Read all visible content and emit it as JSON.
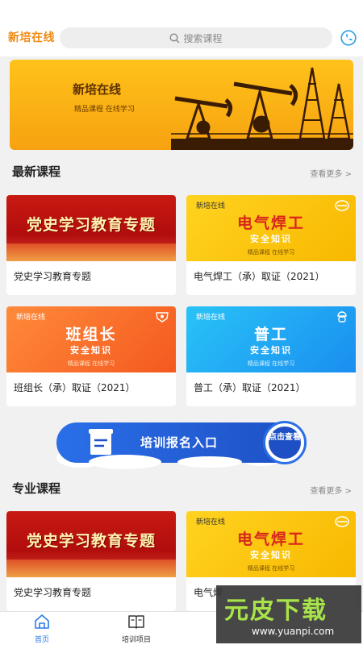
{
  "header": {
    "logo": "新培在线",
    "search_placeholder": "搜索课程",
    "icons": {
      "search": "search-icon",
      "phone": "phone-icon"
    }
  },
  "banner": {
    "title": "新培在线",
    "subtitle": "精品课程 在线学习"
  },
  "latest": {
    "title": "最新课程",
    "more": "查看更多 >",
    "courses": [
      {
        "title": "党史学习教育专题",
        "thumb_text": "党史学习教育专题"
      },
      {
        "title": "电气焊工（承）取证（2021）",
        "brand": "新培在线",
        "big": "电气焊工",
        "small": "安全知识",
        "tagline": "精品课程 在线学习"
      },
      {
        "title": "班组长（承）取证（2021）",
        "brand": "新培在线",
        "big": "班组长",
        "small": "安全知识",
        "tagline": "精品课程 在线学习"
      },
      {
        "title": "普工（承）取证（2021）",
        "brand": "新培在线",
        "big": "普工",
        "small": "安全知识",
        "tagline": "精品课程 在线学习"
      }
    ]
  },
  "register": {
    "label": "培训报名入口",
    "button": "点击查看"
  },
  "professional": {
    "title": "专业课程",
    "more": "查看更多 >",
    "courses": [
      {
        "title": "党史学习教育专题",
        "thumb_text": "党史学习教育专题"
      },
      {
        "title": "电气焊",
        "brand": "新培在线",
        "big": "电气焊工",
        "small": "安全知识",
        "tagline": "精品课程 在线学习"
      }
    ]
  },
  "tabbar": {
    "tabs": [
      {
        "label": "首页",
        "icon": "home-icon",
        "active": true
      },
      {
        "label": "培训项目",
        "icon": "book-icon",
        "active": false
      }
    ]
  },
  "watermark": {
    "text": "元皮下载",
    "url": "www.yuanpi.com"
  },
  "colors": {
    "accent": "#2a7bea",
    "logo": "#f08a12",
    "banner": "#ffc21a"
  }
}
